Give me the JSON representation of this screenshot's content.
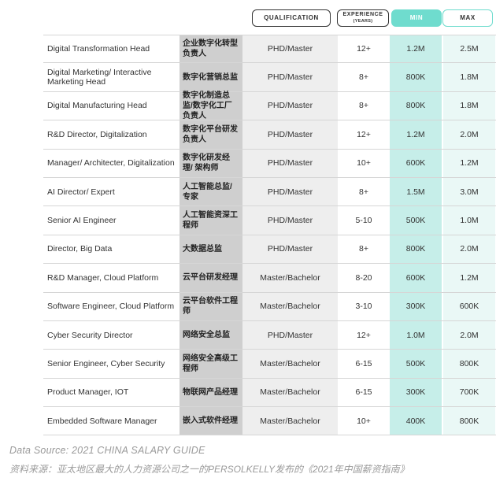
{
  "headers": {
    "qualification": "QUALIFICATION",
    "experience_line1": "EXPERIENCE",
    "experience_line2": "(YEARS)",
    "min": "MIN",
    "max": "MAX"
  },
  "rows": [
    {
      "title_en": "Digital Transformation Head",
      "title_cn": "企业数字化转型负责人",
      "qualification": "PHD/Master",
      "experience": "12+",
      "min": "1.2M",
      "max": "2.5M"
    },
    {
      "title_en": "Digital Marketing/ Interactive Marketing Head",
      "title_cn": "数字化营销总监",
      "qualification": "PHD/Master",
      "experience": "8+",
      "min": "800K",
      "max": "1.8M"
    },
    {
      "title_en": "Digital Manufacturing Head",
      "title_cn": "数字化制造总监/数字化工厂负责人",
      "qualification": "PHD/Master",
      "experience": "8+",
      "min": "800K",
      "max": "1.8M"
    },
    {
      "title_en": "R&D Director, Digitalization",
      "title_cn": "数字化平台研发负责人",
      "qualification": "PHD/Master",
      "experience": "12+",
      "min": "1.2M",
      "max": "2.0M"
    },
    {
      "title_en": "Manager/ Architecter, Digitalization",
      "title_cn": "数字化研发经理/ 架构师",
      "qualification": "PHD/Master",
      "experience": "10+",
      "min": "600K",
      "max": "1.2M"
    },
    {
      "title_en": "AI Director/ Expert",
      "title_cn": "人工智能总监/专家",
      "qualification": "PHD/Master",
      "experience": "8+",
      "min": "1.5M",
      "max": "3.0M"
    },
    {
      "title_en": "Senior AI Engineer",
      "title_cn": "人工智能资深工程师",
      "qualification": "PHD/Master",
      "experience": "5-10",
      "min": "500K",
      "max": "1.0M"
    },
    {
      "title_en": "Director, Big Data",
      "title_cn": "大数据总监",
      "qualification": "PHD/Master",
      "experience": "8+",
      "min": "800K",
      "max": "2.0M"
    },
    {
      "title_en": "R&D Manager, Cloud Platform",
      "title_cn": "云平台研发经理",
      "qualification": "Master/Bachelor",
      "experience": "8-20",
      "min": "600K",
      "max": "1.2M"
    },
    {
      "title_en": "Software Engineer, Cloud Platform",
      "title_cn": "云平台软件工程师",
      "qualification": "Master/Bachelor",
      "experience": "3-10",
      "min": "300K",
      "max": "600K"
    },
    {
      "title_en": "Cyber Security Director",
      "title_cn": "网络安全总监",
      "qualification": "PHD/Master",
      "experience": "12+",
      "min": "1.0M",
      "max": "2.0M"
    },
    {
      "title_en": "Senior Engineer, Cyber Security",
      "title_cn": "网络安全高级工程师",
      "qualification": "Master/Bachelor",
      "experience": "6-15",
      "min": "500K",
      "max": "800K"
    },
    {
      "title_en": "Product Manager, IOT",
      "title_cn": "物联网产品经理",
      "qualification": "Master/Bachelor",
      "experience": "6-15",
      "min": "300K",
      "max": "700K"
    },
    {
      "title_en": "Embedded Software Manager",
      "title_cn": "嵌入式软件经理",
      "qualification": "Master/Bachelor",
      "experience": "10+",
      "min": "400K",
      "max": "800K"
    }
  ],
  "footer": {
    "source_en": "Data Source:  2021 CHINA SALARY GUIDE",
    "source_cn": "资料来源：亚太地区最大的人力资源公司之一的PERSOLKELLY发布的《2021年中国薪资指南》"
  },
  "colors": {
    "accent": "#6fdcce",
    "min_column": "#c6eee9",
    "max_column": "#eaf8f6",
    "cn_column": "#cfcfcf",
    "qual_column": "#eeeeee"
  }
}
